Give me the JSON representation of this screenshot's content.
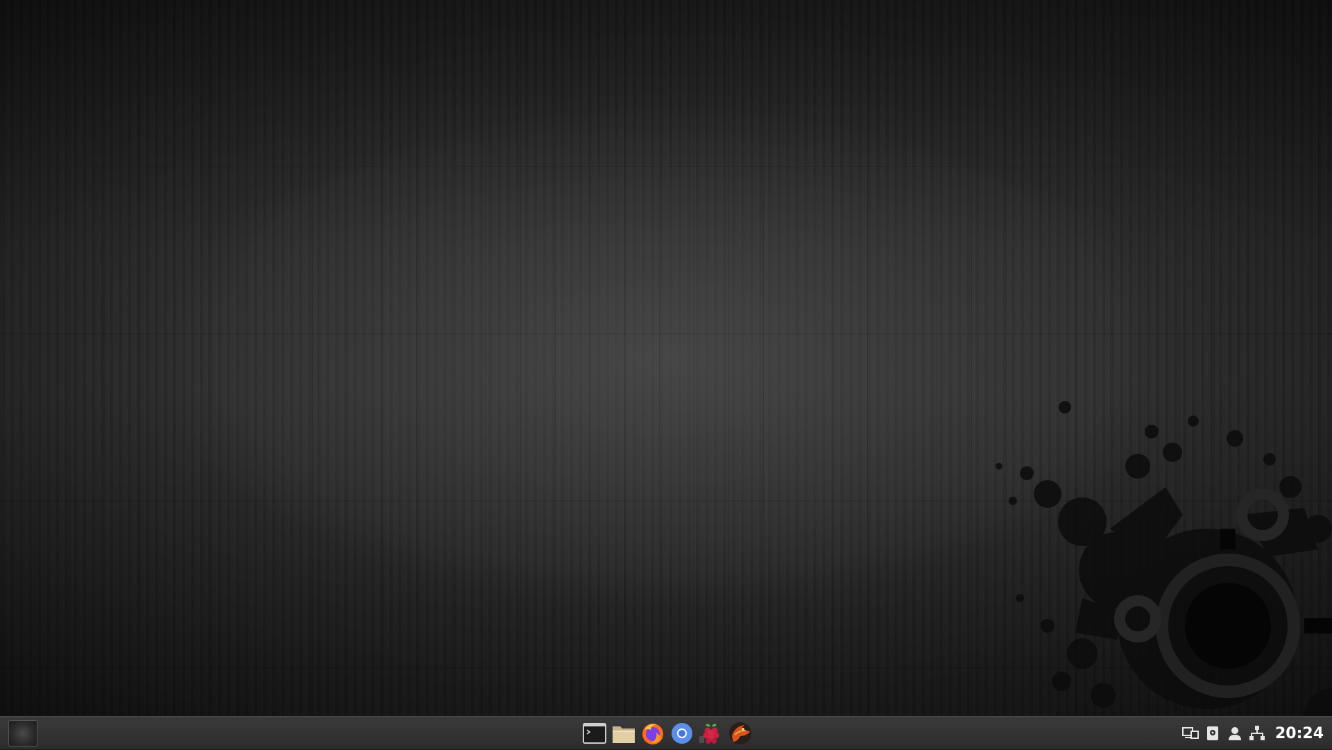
{
  "desktop": {
    "wallpaper": "dark-wood-with-paint-splash-gear",
    "accent": "#2d2d2d"
  },
  "taskbar": {
    "menu_icon": "app-menu-icon",
    "launchers": [
      {
        "name": "terminal-icon"
      },
      {
        "name": "file-manager-icon"
      },
      {
        "name": "firefox-icon"
      },
      {
        "name": "chromium-icon"
      },
      {
        "name": "raspberry-pi-icon"
      },
      {
        "name": "dragon-app-icon"
      }
    ],
    "tray": [
      {
        "name": "display-icon"
      },
      {
        "name": "storage-icon"
      },
      {
        "name": "user-icon"
      },
      {
        "name": "network-icon"
      }
    ],
    "clock": "20:24"
  }
}
